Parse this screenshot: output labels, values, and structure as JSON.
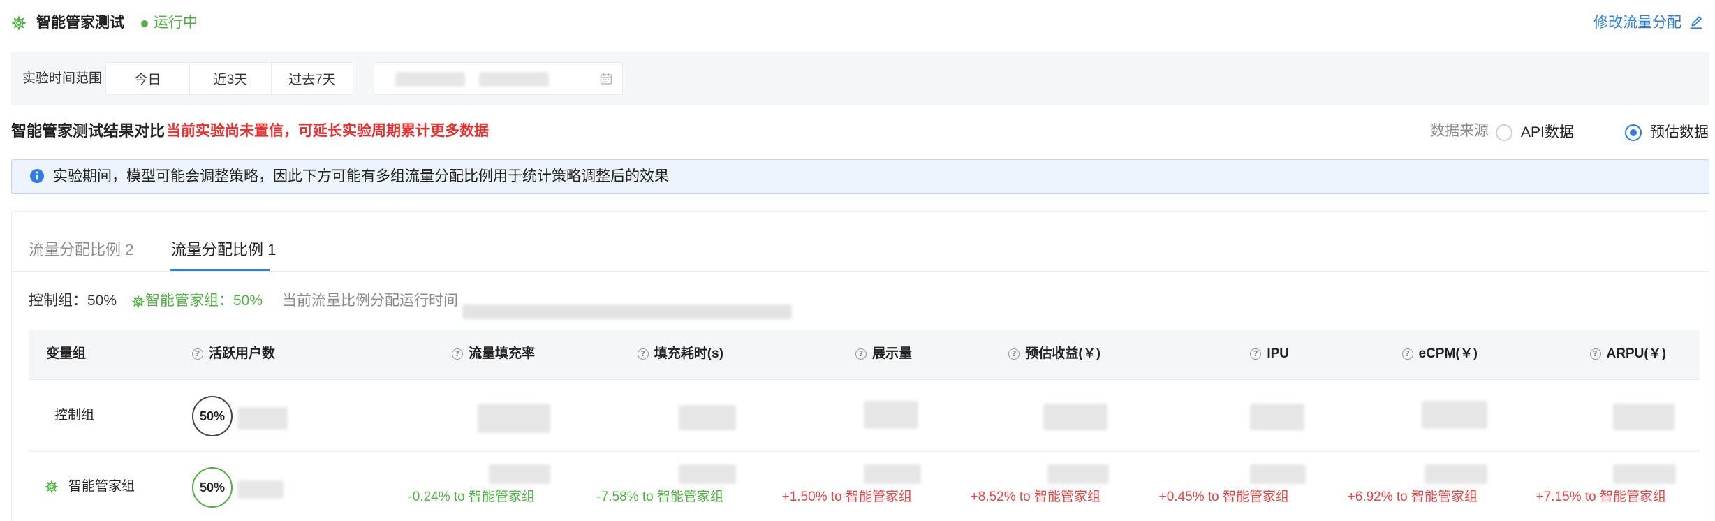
{
  "header": {
    "title": "智能管家测试",
    "status": "运行中",
    "edit_link": "修改流量分配"
  },
  "filter": {
    "label": "实验时间范围",
    "options": [
      "今日",
      "近3天",
      "过去7天"
    ]
  },
  "results": {
    "title": "智能管家测试结果对比",
    "warning": "当前实验尚未置信，可延长实验周期累计更多数据",
    "source_label": "数据来源",
    "source_options": [
      "API数据",
      "预估数据"
    ],
    "selected_source": "预估数据"
  },
  "info_banner": "实验期间，模型可能会调整策略，因此下方可能有多组流量分配比例用于统计策略调整后的效果",
  "tabs": [
    {
      "label": "流量分配比例 2",
      "active": false
    },
    {
      "label": "流量分配比例 1",
      "active": true
    }
  ],
  "summary": {
    "control": "控制组：50%",
    "smart": "智能管家组：50%",
    "runtime_label": "当前流量比例分配运行时间"
  },
  "table": {
    "headers": [
      "变量组",
      "活跃用户数",
      "流量填充率",
      "填充耗时(s)",
      "展示量",
      "预估收益(￥)",
      "IPU",
      "eCPM(￥)",
      "ARPU(￥)"
    ],
    "rows": [
      {
        "name": "控制组",
        "share": "50%"
      },
      {
        "name": "智能管家组",
        "share": "50%"
      }
    ],
    "deltas": [
      "-0.24% to 智能管家组",
      "-7.58% to 智能管家组",
      "+1.50% to 智能管家组",
      "+8.52% to 智能管家组",
      "+0.45% to 智能管家组",
      "+6.92% to 智能管家组",
      "+7.15% to 智能管家组"
    ]
  },
  "colors": {
    "accent": "#2f7ce4",
    "success": "#52b045",
    "danger": "#e53030"
  }
}
